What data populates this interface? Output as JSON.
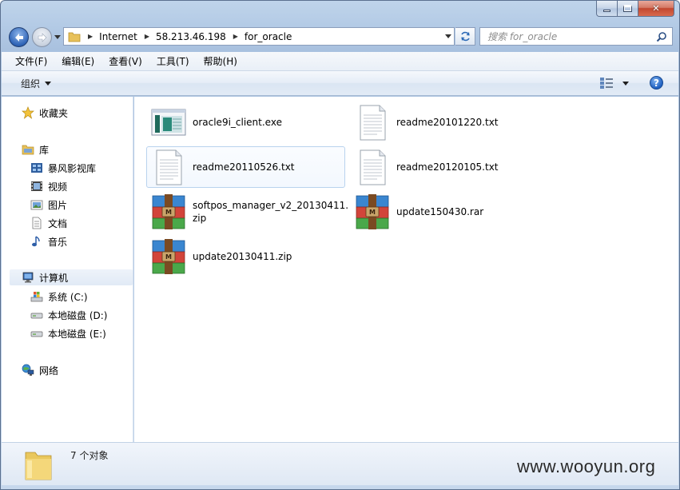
{
  "nav": {
    "breadcrumbs": [
      "Internet",
      "58.213.46.198",
      "for_oracle"
    ]
  },
  "search": {
    "placeholder": "搜索 for_oracle"
  },
  "menu": [
    "文件(F)",
    "编辑(E)",
    "查看(V)",
    "工具(T)",
    "帮助(H)"
  ],
  "toolbar": {
    "organize_label": "组织",
    "help_label": "?"
  },
  "sidebar": {
    "favorites": {
      "label": "收藏夹",
      "icon": "star-icon"
    },
    "libraries": {
      "label": "库",
      "icon": "library-icon",
      "items": [
        {
          "label": "暴风影视库",
          "icon": "video-library-icon"
        },
        {
          "label": "视频",
          "icon": "video-icon"
        },
        {
          "label": "图片",
          "icon": "picture-icon"
        },
        {
          "label": "文档",
          "icon": "document-icon"
        },
        {
          "label": "音乐",
          "icon": "music-icon"
        }
      ]
    },
    "computer": {
      "label": "计算机",
      "icon": "computer-icon",
      "items": [
        {
          "label": "系统 (C:)",
          "icon": "system-drive-icon"
        },
        {
          "label": "本地磁盘 (D:)",
          "icon": "drive-icon"
        },
        {
          "label": "本地磁盘 (E:)",
          "icon": "drive-icon"
        }
      ]
    },
    "network": {
      "label": "网络",
      "icon": "network-icon"
    }
  },
  "files": [
    {
      "name": "oracle9i_client.exe",
      "type": "exe",
      "icon": "exe-icon"
    },
    {
      "name": "readme20101220.txt",
      "type": "txt",
      "icon": "text-file-icon"
    },
    {
      "name": "readme20110526.txt",
      "type": "txt",
      "icon": "text-file-icon"
    },
    {
      "name": "readme20120105.txt",
      "type": "txt",
      "icon": "text-file-icon"
    },
    {
      "name": "softpos_manager_v2_20130411.zip",
      "name_lines": [
        "softpos_manager_v2_20130411.",
        "zip"
      ],
      "type": "zip",
      "icon": "winrar-archive-icon"
    },
    {
      "name": "update150430.rar",
      "type": "rar",
      "icon": "winrar-archive-icon"
    },
    {
      "name": "update20130411.zip",
      "type": "zip",
      "icon": "winrar-archive-icon"
    }
  ],
  "status": {
    "item_count": "7 个对象"
  },
  "watermark": "www.wooyun.org",
  "colors": {
    "accent": "#3a6fc2",
    "hover_border": "#b9d3ee"
  }
}
